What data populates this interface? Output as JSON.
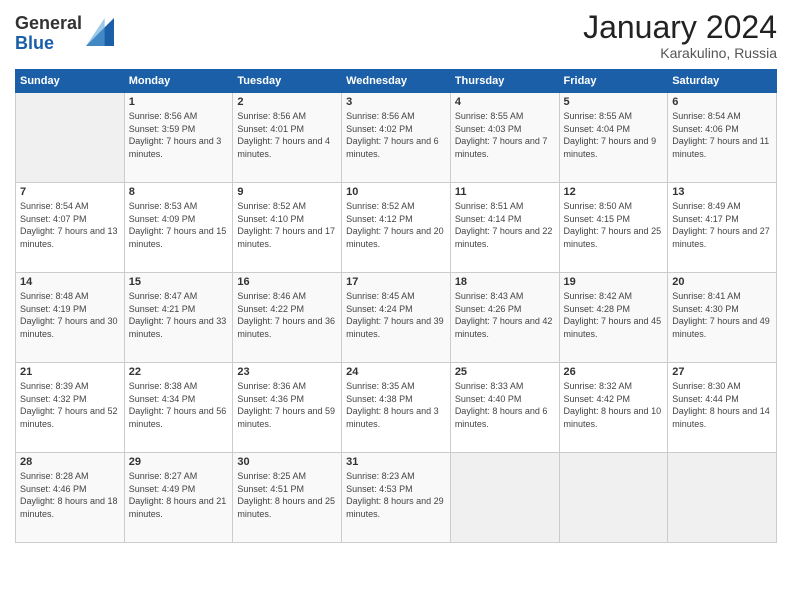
{
  "logo": {
    "general": "General",
    "blue": "Blue"
  },
  "header": {
    "month": "January 2024",
    "location": "Karakulino, Russia"
  },
  "weekdays": [
    "Sunday",
    "Monday",
    "Tuesday",
    "Wednesday",
    "Thursday",
    "Friday",
    "Saturday"
  ],
  "weeks": [
    [
      {
        "day": "",
        "sunrise": "",
        "sunset": "",
        "daylight": ""
      },
      {
        "day": "1",
        "sunrise": "Sunrise: 8:56 AM",
        "sunset": "Sunset: 3:59 PM",
        "daylight": "Daylight: 7 hours and 3 minutes."
      },
      {
        "day": "2",
        "sunrise": "Sunrise: 8:56 AM",
        "sunset": "Sunset: 4:01 PM",
        "daylight": "Daylight: 7 hours and 4 minutes."
      },
      {
        "day": "3",
        "sunrise": "Sunrise: 8:56 AM",
        "sunset": "Sunset: 4:02 PM",
        "daylight": "Daylight: 7 hours and 6 minutes."
      },
      {
        "day": "4",
        "sunrise": "Sunrise: 8:55 AM",
        "sunset": "Sunset: 4:03 PM",
        "daylight": "Daylight: 7 hours and 7 minutes."
      },
      {
        "day": "5",
        "sunrise": "Sunrise: 8:55 AM",
        "sunset": "Sunset: 4:04 PM",
        "daylight": "Daylight: 7 hours and 9 minutes."
      },
      {
        "day": "6",
        "sunrise": "Sunrise: 8:54 AM",
        "sunset": "Sunset: 4:06 PM",
        "daylight": "Daylight: 7 hours and 11 minutes."
      }
    ],
    [
      {
        "day": "7",
        "sunrise": "Sunrise: 8:54 AM",
        "sunset": "Sunset: 4:07 PM",
        "daylight": "Daylight: 7 hours and 13 minutes."
      },
      {
        "day": "8",
        "sunrise": "Sunrise: 8:53 AM",
        "sunset": "Sunset: 4:09 PM",
        "daylight": "Daylight: 7 hours and 15 minutes."
      },
      {
        "day": "9",
        "sunrise": "Sunrise: 8:52 AM",
        "sunset": "Sunset: 4:10 PM",
        "daylight": "Daylight: 7 hours and 17 minutes."
      },
      {
        "day": "10",
        "sunrise": "Sunrise: 8:52 AM",
        "sunset": "Sunset: 4:12 PM",
        "daylight": "Daylight: 7 hours and 20 minutes."
      },
      {
        "day": "11",
        "sunrise": "Sunrise: 8:51 AM",
        "sunset": "Sunset: 4:14 PM",
        "daylight": "Daylight: 7 hours and 22 minutes."
      },
      {
        "day": "12",
        "sunrise": "Sunrise: 8:50 AM",
        "sunset": "Sunset: 4:15 PM",
        "daylight": "Daylight: 7 hours and 25 minutes."
      },
      {
        "day": "13",
        "sunrise": "Sunrise: 8:49 AM",
        "sunset": "Sunset: 4:17 PM",
        "daylight": "Daylight: 7 hours and 27 minutes."
      }
    ],
    [
      {
        "day": "14",
        "sunrise": "Sunrise: 8:48 AM",
        "sunset": "Sunset: 4:19 PM",
        "daylight": "Daylight: 7 hours and 30 minutes."
      },
      {
        "day": "15",
        "sunrise": "Sunrise: 8:47 AM",
        "sunset": "Sunset: 4:21 PM",
        "daylight": "Daylight: 7 hours and 33 minutes."
      },
      {
        "day": "16",
        "sunrise": "Sunrise: 8:46 AM",
        "sunset": "Sunset: 4:22 PM",
        "daylight": "Daylight: 7 hours and 36 minutes."
      },
      {
        "day": "17",
        "sunrise": "Sunrise: 8:45 AM",
        "sunset": "Sunset: 4:24 PM",
        "daylight": "Daylight: 7 hours and 39 minutes."
      },
      {
        "day": "18",
        "sunrise": "Sunrise: 8:43 AM",
        "sunset": "Sunset: 4:26 PM",
        "daylight": "Daylight: 7 hours and 42 minutes."
      },
      {
        "day": "19",
        "sunrise": "Sunrise: 8:42 AM",
        "sunset": "Sunset: 4:28 PM",
        "daylight": "Daylight: 7 hours and 45 minutes."
      },
      {
        "day": "20",
        "sunrise": "Sunrise: 8:41 AM",
        "sunset": "Sunset: 4:30 PM",
        "daylight": "Daylight: 7 hours and 49 minutes."
      }
    ],
    [
      {
        "day": "21",
        "sunrise": "Sunrise: 8:39 AM",
        "sunset": "Sunset: 4:32 PM",
        "daylight": "Daylight: 7 hours and 52 minutes."
      },
      {
        "day": "22",
        "sunrise": "Sunrise: 8:38 AM",
        "sunset": "Sunset: 4:34 PM",
        "daylight": "Daylight: 7 hours and 56 minutes."
      },
      {
        "day": "23",
        "sunrise": "Sunrise: 8:36 AM",
        "sunset": "Sunset: 4:36 PM",
        "daylight": "Daylight: 7 hours and 59 minutes."
      },
      {
        "day": "24",
        "sunrise": "Sunrise: 8:35 AM",
        "sunset": "Sunset: 4:38 PM",
        "daylight": "Daylight: 8 hours and 3 minutes."
      },
      {
        "day": "25",
        "sunrise": "Sunrise: 8:33 AM",
        "sunset": "Sunset: 4:40 PM",
        "daylight": "Daylight: 8 hours and 6 minutes."
      },
      {
        "day": "26",
        "sunrise": "Sunrise: 8:32 AM",
        "sunset": "Sunset: 4:42 PM",
        "daylight": "Daylight: 8 hours and 10 minutes."
      },
      {
        "day": "27",
        "sunrise": "Sunrise: 8:30 AM",
        "sunset": "Sunset: 4:44 PM",
        "daylight": "Daylight: 8 hours and 14 minutes."
      }
    ],
    [
      {
        "day": "28",
        "sunrise": "Sunrise: 8:28 AM",
        "sunset": "Sunset: 4:46 PM",
        "daylight": "Daylight: 8 hours and 18 minutes."
      },
      {
        "day": "29",
        "sunrise": "Sunrise: 8:27 AM",
        "sunset": "Sunset: 4:49 PM",
        "daylight": "Daylight: 8 hours and 21 minutes."
      },
      {
        "day": "30",
        "sunrise": "Sunrise: 8:25 AM",
        "sunset": "Sunset: 4:51 PM",
        "daylight": "Daylight: 8 hours and 25 minutes."
      },
      {
        "day": "31",
        "sunrise": "Sunrise: 8:23 AM",
        "sunset": "Sunset: 4:53 PM",
        "daylight": "Daylight: 8 hours and 29 minutes."
      },
      {
        "day": "",
        "sunrise": "",
        "sunset": "",
        "daylight": ""
      },
      {
        "day": "",
        "sunrise": "",
        "sunset": "",
        "daylight": ""
      },
      {
        "day": "",
        "sunrise": "",
        "sunset": "",
        "daylight": ""
      }
    ]
  ]
}
